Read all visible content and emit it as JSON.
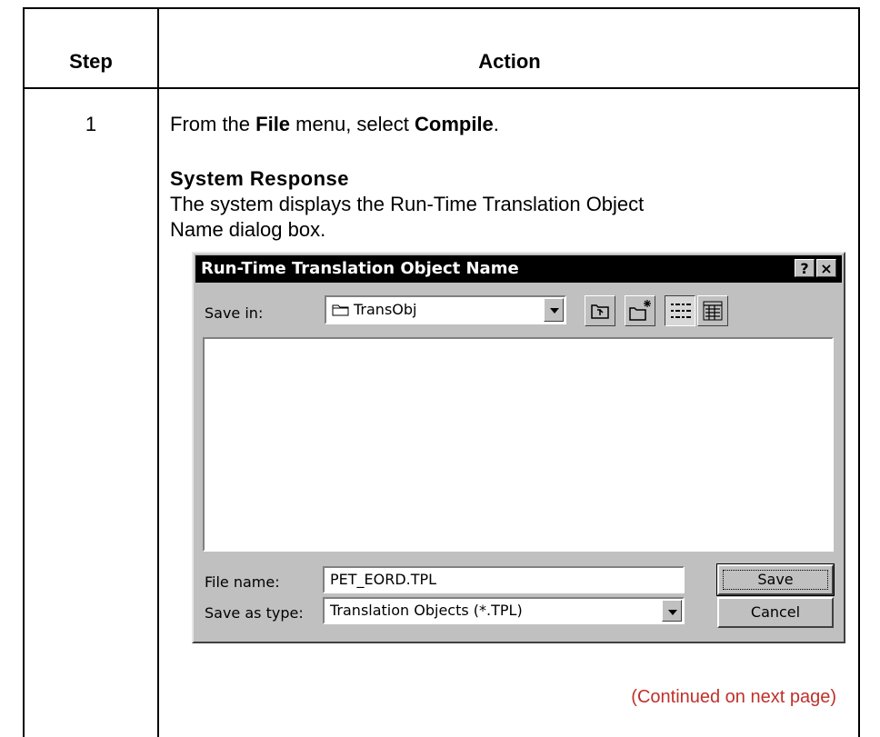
{
  "table": {
    "header_step": "Step",
    "header_action": "Action",
    "step_number": "1",
    "instruction": {
      "pre": "From the ",
      "menu": "File",
      "mid": " menu, select ",
      "item": "Compile",
      "post": "."
    },
    "system_response_title": "System Response",
    "system_response_text": "The system displays the Run-Time Translation Object Name dialog box.",
    "continued": "(Continued on next page)"
  },
  "dialog": {
    "title": "Run-Time Translation Object Name",
    "help_button": "?",
    "close_button": "×",
    "save_in_label": "Save in:",
    "save_in_value": "TransObj",
    "file_name_label": "File name:",
    "file_name_value": "PET_EORD.TPL",
    "save_as_type_label": "Save as type:",
    "save_as_type_value": "Translation Objects (*.TPL)",
    "save_button": "Save",
    "cancel_button": "Cancel",
    "toolbar_icons": [
      "up-one-level-icon",
      "create-new-folder-icon",
      "list-view-icon",
      "details-view-icon"
    ]
  },
  "colors": {
    "continued_text": "#c0302a",
    "dialog_face": "#c0c0c0",
    "titlebar": "#000000"
  }
}
